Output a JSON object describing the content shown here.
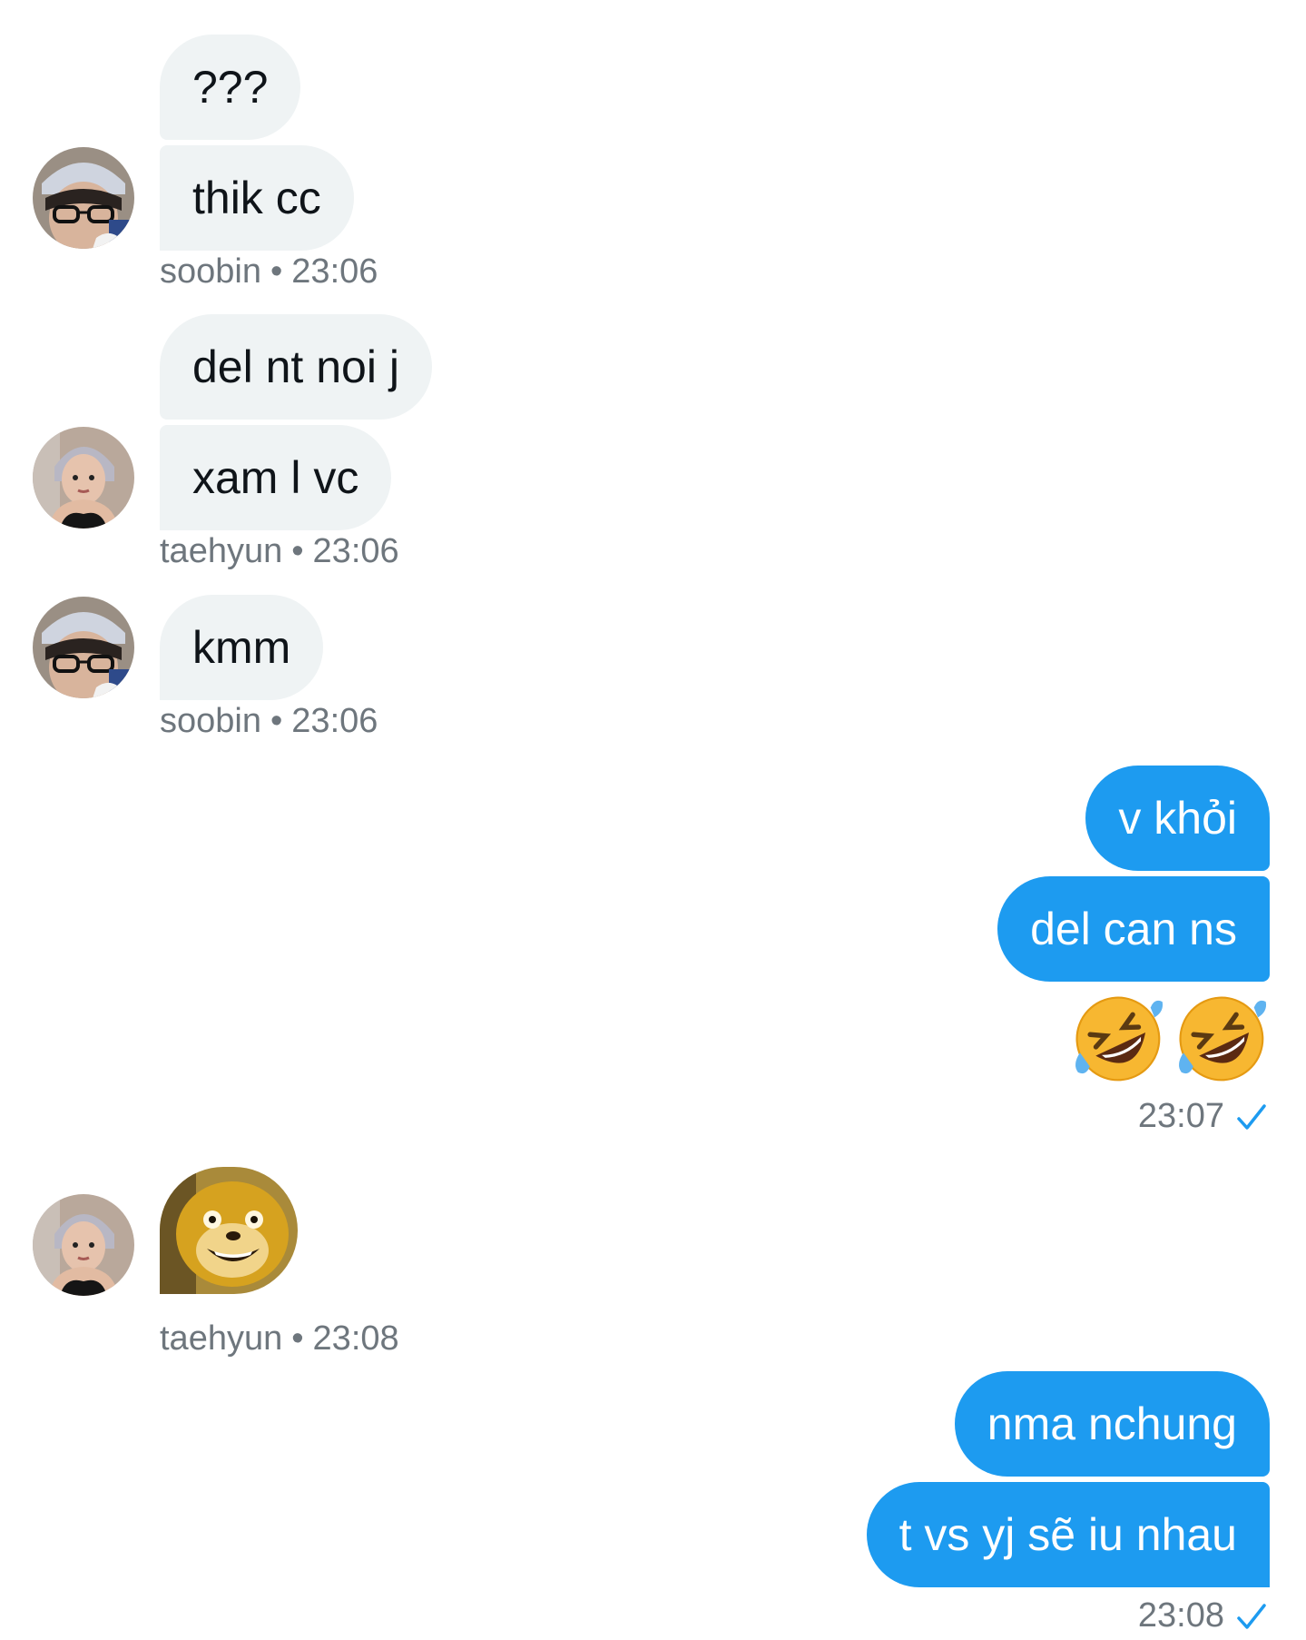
{
  "conversation": {
    "groups": [
      {
        "sender": "soobin",
        "time": "23:06",
        "messages": [
          "???",
          "thik cc"
        ]
      },
      {
        "sender": "taehyun",
        "time": "23:06",
        "messages": [
          "del nt noi j",
          "xam l vc"
        ]
      },
      {
        "sender": "soobin",
        "time": "23:06",
        "messages": [
          "kmm"
        ]
      },
      {
        "sender": "me",
        "time": "23:07",
        "messages": [
          "v khỏi",
          "del can ns"
        ],
        "emojis": [
          "rolling-on-floor-laughing",
          "rolling-on-floor-laughing"
        ]
      },
      {
        "sender": "taehyun",
        "time": "23:08",
        "sticker": "shiba-dog-sticker"
      },
      {
        "sender": "me",
        "time": "23:08",
        "messages": [
          "nma nchung",
          "t vs yj sẽ iu nhau"
        ]
      }
    ],
    "separator": "•",
    "colors": {
      "incoming_bubble": "#eff3f4",
      "outgoing_bubble": "#1d9bf0",
      "meta_text": "#6e767d",
      "check": "#1d9bf0"
    }
  }
}
